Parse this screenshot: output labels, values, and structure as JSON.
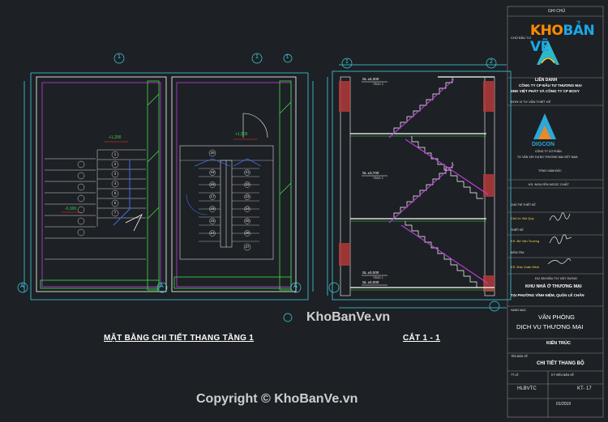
{
  "drawing": {
    "plan_title": "MẶT BẰNG CHI TIẾT THANG TẦNG 1",
    "section_title": "CẮT 1 - 1",
    "axis_labels": {
      "left_top": "1",
      "mid_top": "1",
      "right_top": "1",
      "bottom_left": "A",
      "bottom_mid": "A",
      "bottom_right": "A",
      "sec_top": "1",
      "sec_right_top": "2"
    },
    "levels": [
      {
        "text": "SL ±5,300",
        "sub": "TẦNG 3"
      },
      {
        "text": "SL ±3,700",
        "sub": "TẦNG 2"
      },
      {
        "text": "SL ±0,000",
        "sub": "TẦNG 1"
      },
      {
        "text": "SL ±0,000",
        "sub": "TẦNG 1"
      }
    ],
    "plan_levels": [
      "+1,200",
      "+1,500",
      "-0,300"
    ],
    "steps_left": [
      "1",
      "2",
      "3",
      "4",
      "5",
      "6",
      "7"
    ],
    "steps_right_col1": [
      "20",
      "19",
      "18",
      "17",
      "16",
      "15",
      "14",
      "13",
      "12",
      "11"
    ],
    "steps_right_col2": [
      "21",
      "22",
      "23",
      "24",
      "25",
      "26",
      "27",
      "28",
      "29",
      "30"
    ]
  },
  "title_block": {
    "header": "GHI CHÚ",
    "client_label": "CHỦ ĐẦU TƯ",
    "client_name_1": "LIÊN DANH",
    "client_name_2": "CÔNG TY CP ĐẦU TƯ THƯƠNG MẠI",
    "client_name_3": "XNK VIỆT PHÁT VÀ CÔNG TY CP BOXY",
    "consultant_label": "ĐƠN VỊ TƯ VẤN THIẾT KẾ",
    "consultant_brand": "DIGCON",
    "consultant_line_1": "CÔNG TY CỔ PHẦN",
    "consultant_line_2": "TƯ VẤN XÂY DỰNG THƯƠNG MẠI VIỆT NAM",
    "consultant_line_3": "TỔNG GIÁM ĐỐC",
    "director": "KS. NGUYỄN NGỌC CHẤT",
    "roles": [
      {
        "role": "CHỦ TRÌ THIẾT KẾ",
        "name": "Chủ trì: Bùi Quý"
      },
      {
        "role": "THIẾT KẾ",
        "name": "KS. Bế Văn Trường"
      },
      {
        "role": "KIỂM TRA",
        "name": "KS. Đào Xuân Minh"
      }
    ],
    "project_label": "DỰ ÁN ĐẦU TƯ XÂY DỰNG",
    "project_name_1": "KHU NHÀ Ở THƯƠNG MẠI",
    "project_name_2": "TẠI PHƯỜNG VĨNH NIỆM, QUẬN LÊ CHÂN",
    "item_label": "HẠNG MỤC",
    "item_name_1": "VĂN PHÒNG",
    "item_name_2": "DỊCH VỤ THƯƠNG MẠI",
    "stage": "KIẾN TRÚC",
    "drawing_label": "TÊN BẢN VẼ",
    "drawing_name": "CHI TIẾT THANG BỘ",
    "scale_label": "TỶ LỆ",
    "sheet_label": "KÝ HIỆU BẢN VẼ",
    "sheet_no": "KT- 17",
    "phase": "HLBVTC",
    "date": "01/2019"
  },
  "watermarks": {
    "logo_part1": "KHO",
    "logo_part2": "BẢN VẼ",
    "center": "KhoBanVe.vn",
    "footer": "Copyright © KhoBanVe.vn"
  }
}
